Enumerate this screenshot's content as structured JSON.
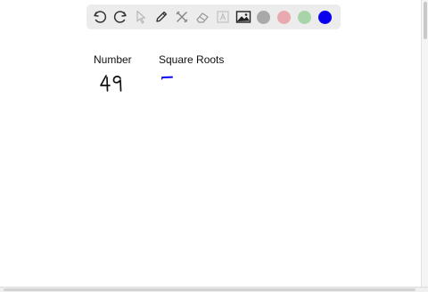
{
  "toolbar": {
    "tools": [
      {
        "name": "undo-icon",
        "enabled": true
      },
      {
        "name": "redo-icon",
        "enabled": true
      },
      {
        "name": "pointer-icon",
        "enabled": false
      },
      {
        "name": "pen-icon",
        "enabled": true
      },
      {
        "name": "tools-icon",
        "enabled": true
      },
      {
        "name": "eraser-icon",
        "enabled": true
      },
      {
        "name": "text-icon",
        "enabled": false
      },
      {
        "name": "image-icon",
        "enabled": true
      }
    ],
    "colors": [
      "#a9a9a9",
      "#eaa9ae",
      "#a9d4a9",
      "#0a00f0"
    ],
    "selected_color": "#0a00f0"
  },
  "canvas": {
    "header_number": "Number",
    "header_square_roots": "Square Roots",
    "handwritten_number": "49"
  }
}
